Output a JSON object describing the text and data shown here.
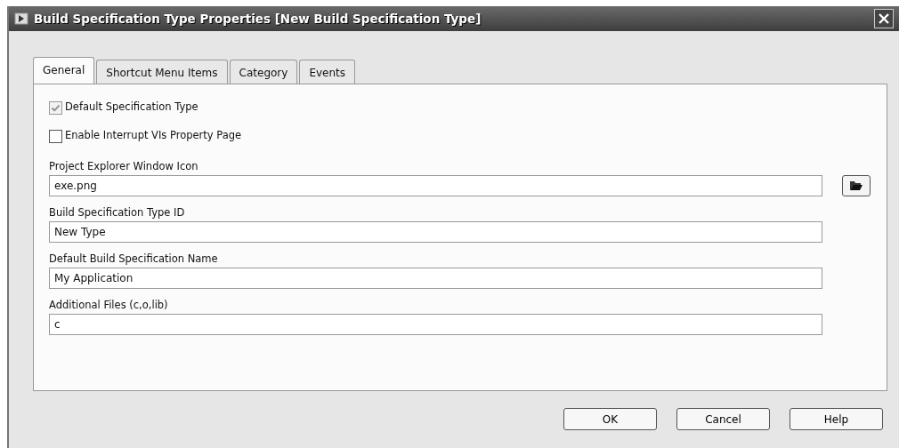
{
  "window": {
    "title": "Build Specification Type Properties [New Build Specification Type]"
  },
  "tabs": [
    {
      "label": "General",
      "selected": true
    },
    {
      "label": "Shortcut Menu Items",
      "selected": false
    },
    {
      "label": "Category",
      "selected": false
    },
    {
      "label": "Events",
      "selected": false
    }
  ],
  "checkboxes": [
    {
      "label": "Default Specification Type",
      "checked": true,
      "disabled": true
    },
    {
      "label": "Enable Interrupt VIs Property Page",
      "checked": false,
      "disabled": false
    }
  ],
  "fields": [
    {
      "label": "Project Explorer Window Icon",
      "value": "exe.png",
      "browse": true
    },
    {
      "label": "Build Specification Type ID",
      "value": "New Type",
      "browse": false
    },
    {
      "label": "Default Build Specification Name",
      "value": "My Application",
      "browse": false
    },
    {
      "label": "Additional Files (c,o,lib)",
      "value": "c",
      "browse": false
    }
  ],
  "buttons": [
    "OK",
    "Cancel",
    "Help"
  ]
}
